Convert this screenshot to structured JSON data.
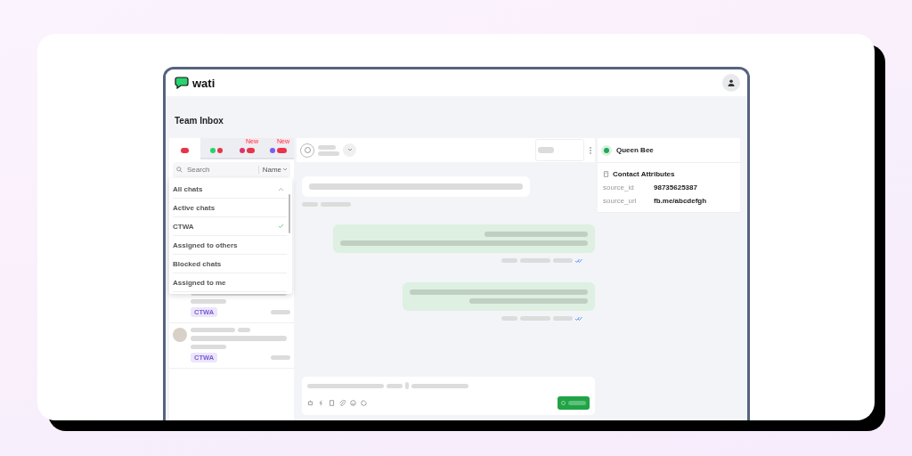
{
  "app": {
    "logo": "wati"
  },
  "page_title": "Team Inbox",
  "channel_tabs": [
    {
      "kind": "all",
      "selected": true
    },
    {
      "kind": "whatsapp",
      "selected": false
    },
    {
      "kind": "instagram",
      "selected": false,
      "new_label": "New"
    },
    {
      "kind": "messenger",
      "selected": false,
      "new_label": "New"
    }
  ],
  "search": {
    "placeholder": "Search",
    "sort": "Name"
  },
  "filter_menu": {
    "expanded": true,
    "items": [
      {
        "kind": "header",
        "label": "All chats",
        "checked": false
      },
      {
        "kind": "option",
        "label": "Active chats",
        "checked": false
      },
      {
        "kind": "option",
        "label": "CTWA",
        "checked": true
      },
      {
        "kind": "option",
        "label": "Assigned to others",
        "checked": false
      },
      {
        "kind": "option",
        "label": "Blocked chats",
        "checked": false
      },
      {
        "kind": "option",
        "label": "Assigned to me",
        "checked": false
      }
    ]
  },
  "chats": [
    {
      "tag": "CTWA",
      "avatar": false
    },
    {
      "tag": "CTWA",
      "avatar": true
    }
  ],
  "messages": [
    {
      "kind": "incoming",
      "read": false
    },
    {
      "kind": "outgoing",
      "read": true
    },
    {
      "kind": "outgoing",
      "read": true
    }
  ],
  "contact": {
    "name": "Queen Bee",
    "section": "Contact Attributes",
    "attributes": [
      {
        "key": "source_id",
        "value": "98735625387"
      },
      {
        "key": "source_url",
        "value": "fb.me/abcdefgh"
      }
    ]
  }
}
